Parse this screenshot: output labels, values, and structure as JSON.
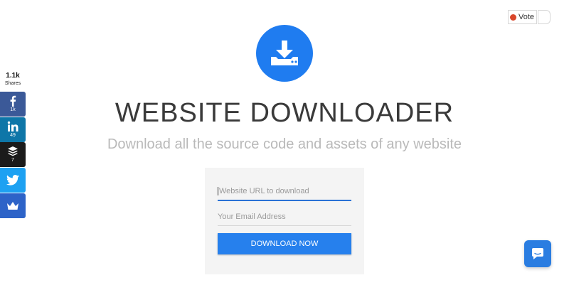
{
  "vote": {
    "label": "Vote"
  },
  "share": {
    "total": "1.1k",
    "total_label": "Shares",
    "buttons": [
      {
        "network": "facebook",
        "icon": "facebook-icon",
        "count": "1k",
        "color": "#3b5998"
      },
      {
        "network": "linkedin",
        "icon": "linkedin-icon",
        "count": "49",
        "color": "#0e76a8"
      },
      {
        "network": "buffer",
        "icon": "buffer-icon",
        "count": "7",
        "color": "#1b1b1b"
      },
      {
        "network": "twitter",
        "icon": "twitter-icon",
        "count": "",
        "color": "#1da1f2"
      },
      {
        "network": "sumome",
        "icon": "crown-icon",
        "count": "",
        "color": "#2d63c8"
      }
    ]
  },
  "hero": {
    "logo_icon": "download-icon",
    "title": "WEBSITE DOWNLOADER",
    "subtitle": "Download all the source code and assets of any website"
  },
  "form": {
    "url_placeholder": "Website URL to download",
    "url_value": "",
    "email_placeholder": "Your Email Address",
    "email_value": "",
    "submit_label": "DOWNLOAD NOW"
  },
  "chat": {
    "icon": "chat-icon"
  },
  "colors": {
    "accent": "#1f7cf0",
    "button": "#2680ed",
    "title": "#3a3a3a",
    "subtitle": "#b9b9b9"
  }
}
